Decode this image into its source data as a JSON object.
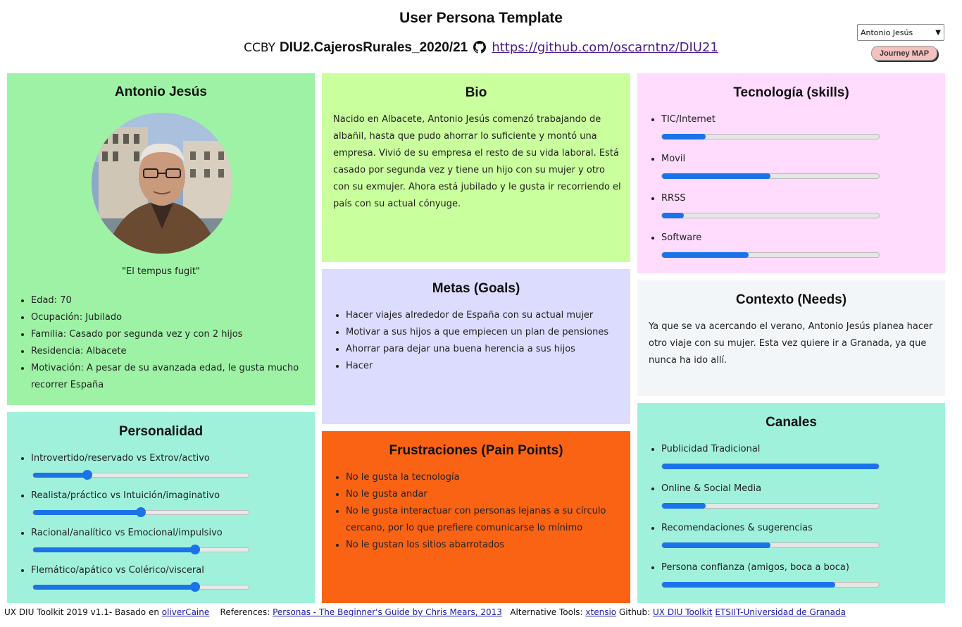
{
  "header": {
    "title": "User Persona Template",
    "cc": "CCBY",
    "project": "DIU2.CajerosRurales_2020/21",
    "repo_link": "https://github.com/oscarntnz/DIU21",
    "persona_selected": "Antonio Jesús",
    "journey_button": "Journey MAP"
  },
  "profile": {
    "name": "Antonio Jesús",
    "quote": "\"El tempus fugit\"",
    "items": [
      "Edad: 70",
      "Ocupación: Jubilado",
      "Familia: Casado por segunda vez y con 2 hijos",
      "Residencia: Albacete",
      "Motivación: A pesar de su avanzada edad, le gusta mucho recorrer España"
    ]
  },
  "bio": {
    "title": "Bio",
    "text": "Nacido en Albacete, Antonio Jesús comenzó trabajando de albañil, hasta que pudo ahorrar lo suficiente y montó una empresa. Vivió de su empresa el resto de su vida laboral. Está casado por segunda vez y tiene un hijo con su mujer y otro con su exmujer. Ahora está jubilado y le gusta ir recorriendo el país con su actual cónyuge."
  },
  "skills": {
    "title": "Tecnología (skills)",
    "items": [
      {
        "label": "TIC/Internet",
        "value": 0.2
      },
      {
        "label": "Movil",
        "value": 0.5
      },
      {
        "label": "RRSS",
        "value": 0.1
      },
      {
        "label": "Software",
        "value": 0.4
      }
    ]
  },
  "goals": {
    "title": "Metas (Goals)",
    "items": [
      "Hacer viajes alrededor de España con su actual mujer",
      "Motivar a sus hijos a que empiecen un plan de pensiones",
      "Ahorrar para dejar una buena herencia a sus hijos",
      "Hacer"
    ]
  },
  "context": {
    "title": "Contexto (Needs)",
    "text": "Ya que se va acercando el verano, Antonio Jesús planea hacer otro viaje con su mujer. Esta vez quiere ir a Granada, ya que nunca ha ido allí."
  },
  "personality": {
    "title": "Personalidad",
    "items": [
      {
        "label": "Introvertido/reservado vs Extrov/activo",
        "value": 0.25
      },
      {
        "label": "Realista/práctico vs Intuición/imaginativo",
        "value": 0.5
      },
      {
        "label": "Racional/analítico vs Emocional/impulsivo",
        "value": 0.75
      },
      {
        "label": "Flemático/apático vs Colérico/visceral",
        "value": 0.75
      }
    ]
  },
  "frustrations": {
    "title": "Frustraciones (Pain Points)",
    "items": [
      "No le gusta la tecnología",
      "No le gusta andar",
      "No le gusta interactuar con personas lejanas a su círculo cercano, por lo que prefiere comunicarse lo mínimo",
      "No le gustan los sitios abarrotados"
    ]
  },
  "channels": {
    "title": "Canales",
    "items": [
      {
        "label": "Publicidad Tradicional",
        "value": 1.0
      },
      {
        "label": "Online & Social Media",
        "value": 0.2
      },
      {
        "label": "Recomendaciones & sugerencias",
        "value": 0.5
      },
      {
        "label": "Persona confianza (amigos, boca a boca)",
        "value": 0.8
      }
    ]
  },
  "footer": {
    "t1": "UX DIU Toolkit 2019 v1.1- Basado en ",
    "l1": "oliverCaine",
    "t2": "References: ",
    "l2": "Personas - The Beginner's Guide by Chris Mears, 2013",
    "t3": "Alternative Tools: ",
    "l3": "xtensio",
    "t4": "Github: ",
    "l4": "UX DIU Toolkit",
    "l5": "ETSIIT-Universidad de Granada"
  },
  "colors": {
    "profile": "#9ef2a5",
    "bio": "#caff9d",
    "skills": "#ffdbfd",
    "goals": "#dcdcfe",
    "context": "#f3f6f9",
    "personality": "#a0f1db",
    "frustrations": "#fa6314",
    "channels": "#a0f1db",
    "accent": "#1a73e8"
  }
}
